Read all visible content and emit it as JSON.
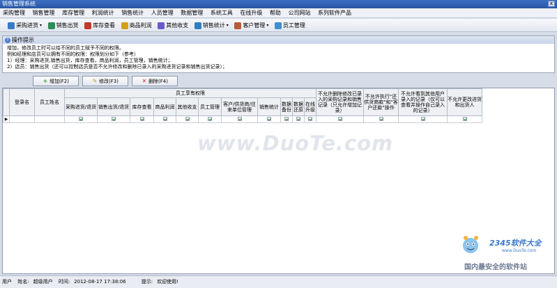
{
  "window": {
    "title": "销售管理系统",
    "close_glyph": "x"
  },
  "menu": [
    "采购管理",
    "销售管理",
    "库存管理",
    "利润统计",
    "销售统计",
    "人员管理",
    "数据管理",
    "系统工具",
    "在线升级",
    "帮助",
    "公司网站",
    "系列软件产品"
  ],
  "toolbar": [
    {
      "label": "采购进货",
      "icon": "purchase-icon",
      "color": "#3a78c8",
      "dropdown": true
    },
    {
      "label": "销售出货",
      "icon": "sales-icon",
      "color": "#2e8b57",
      "dropdown": false
    },
    {
      "label": "库存查看",
      "icon": "inventory-icon",
      "color": "#c0392b",
      "dropdown": false
    },
    {
      "label": "商品利润",
      "icon": "profit-icon",
      "color": "#d4a017",
      "dropdown": false
    },
    {
      "label": "其他收支",
      "icon": "finance-icon",
      "color": "#6a5acd",
      "dropdown": false
    },
    {
      "label": "销售统计",
      "icon": "stats-icon",
      "color": "#2f7fbf",
      "dropdown": true
    },
    {
      "label": "客户管理",
      "icon": "customer-icon",
      "color": "#b85c38",
      "dropdown": true
    },
    {
      "label": "员工管理",
      "icon": "staff-icon",
      "color": "#3f8fcf",
      "dropdown": false
    }
  ],
  "tips": {
    "heading": "操作提示",
    "lines": [
      "增加，修改员工时可以给不同的员工赋予不同的权限。",
      "例如经理和店员可以拥有不同的权限：权限划分如下（参考）",
      "1）经理：采购进货,销售出货，库存查看，商品利润，员工管理，销售统计；",
      "2）店员：销售出货（还可以控制店员是否不允许修改和删除已录入的采购进货记录和销售出货记录）；"
    ]
  },
  "actions": [
    {
      "label": "增加(F2)",
      "icon": "add-icon",
      "glyph": "+",
      "color": "#2e9b2e"
    },
    {
      "label": "修改(F3)",
      "icon": "edit-icon",
      "glyph": "✎",
      "color": "#d08a1a"
    },
    {
      "label": "删除(F4)",
      "icon": "delete-icon",
      "glyph": "✕",
      "color": "#cc2a2a"
    }
  ],
  "table": {
    "group_header": "员工享有权限",
    "col_login": "登录名",
    "col_name": "员工姓名",
    "perm_columns": [
      "采购进货/退货",
      "销售出货/退货",
      "库存查看",
      "商品利润",
      "其他收支",
      "员工管理",
      "客户/供货商/往来单位管理",
      "销售统计",
      "数据备份",
      "数据还原",
      "在线升级"
    ],
    "extra_columns": [
      "不允许删除修改已录入的采购记录和销售记录（只允许增加记录）",
      "不允许执行\"还供货商款\"和\"客户还款\"操作",
      "不允许看到其他用户录入的记录（仅可以查看并操作自己录入的记录）",
      "不允许更改进货和出货人"
    ],
    "row_marker": "▶",
    "row": {
      "login": "",
      "name": "",
      "perms": [
        true,
        true,
        true,
        true,
        true,
        true,
        true,
        true,
        true,
        true,
        true
      ],
      "extras": [
        true,
        true,
        true,
        true
      ]
    }
  },
  "watermark": "www.DuoTe.com",
  "logo": {
    "name": "2345软件大全",
    "url": "www.DuoTe.com",
    "slogan": "国内最安全的软件站"
  },
  "status": {
    "user_label": "用户",
    "name_label": "姓名:",
    "name_value": "超级用户",
    "time_label": "时间:",
    "time_value": "2012-08-17 17:38:06",
    "tip_label": "提示:",
    "tip_value": "欢迎使用!"
  }
}
